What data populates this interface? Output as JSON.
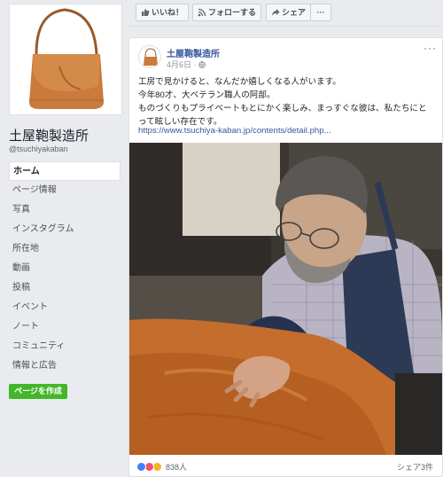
{
  "page": {
    "name": "土屋鞄製造所",
    "handle": "@tsuchiyakaban"
  },
  "nav": {
    "items": [
      {
        "label": "ホーム",
        "active": true
      },
      {
        "label": "ページ情報"
      },
      {
        "label": "写真"
      },
      {
        "label": "インスタグラム"
      },
      {
        "label": "所在地"
      },
      {
        "label": "動画"
      },
      {
        "label": "投稿"
      },
      {
        "label": "イベント"
      },
      {
        "label": "ノート"
      },
      {
        "label": "コミュニティ"
      },
      {
        "label": "情報と広告"
      }
    ],
    "create_page_label": "ページを作成"
  },
  "actions": {
    "like_label": "いいね！",
    "follow_label": "フォローする",
    "share_label": "シェア",
    "more_label": "···"
  },
  "post": {
    "author": "土屋鞄製造所",
    "date": "4月6日",
    "privacy_icon": "globe-icon",
    "text_lines": [
      "工房で見かけると、なんだか嬉しくなる人がいます。",
      "今年80才、大ベテラン職人の阿部。",
      "ものづくりもプライベートもとにかく楽しみ、まっすぐな彼は、私たちにと",
      "って眩しい存在です。"
    ],
    "link": "https://www.tsuchiya-kaban.jp/contents/detail.php...",
    "reaction_count": "838人",
    "share_count": "シェア3件",
    "options_label": "···"
  },
  "colors": {
    "background": "#e9ebee",
    "link": "#365899",
    "create_button": "#42b72a",
    "like_reaction": "#4080ff",
    "love_reaction": "#f25268",
    "wow_reaction": "#f7b125"
  }
}
